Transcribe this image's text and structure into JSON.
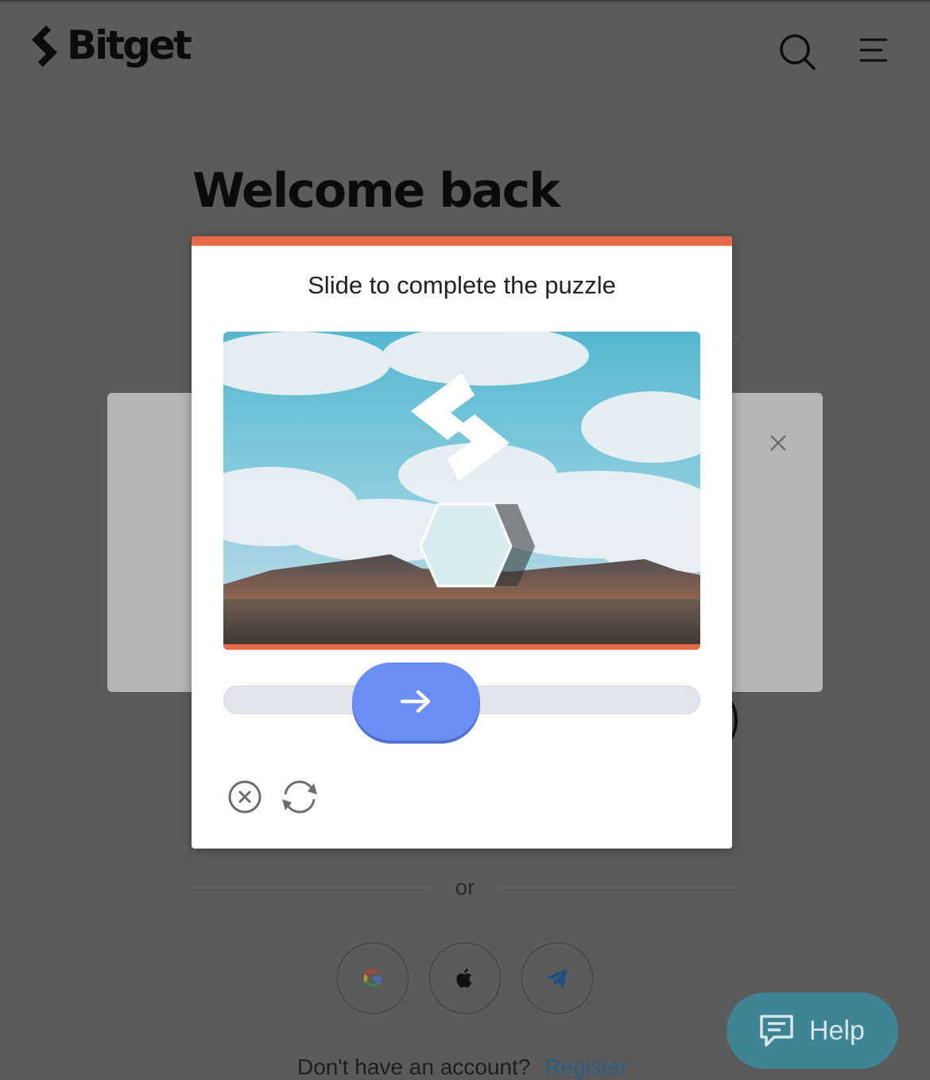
{
  "header": {
    "logo_text": "Bitget",
    "search_icon": "search-icon",
    "menu_icon": "menu-icon"
  },
  "page": {
    "title": "Welcome back",
    "or_label": "or",
    "no_account_text": "Don't have an account?",
    "register_link": "Register"
  },
  "social": [
    "google-icon",
    "apple-icon",
    "telegram-icon"
  ],
  "help": {
    "label": "Help",
    "icon": "chat-icon"
  },
  "captcha": {
    "title": "Slide to complete the puzzle",
    "slider_icon": "arrow-right-icon",
    "slider_position": 0.37,
    "close_icon": "close-circle-icon",
    "refresh_icon": "refresh-icon"
  },
  "colors": {
    "accent": "#e8684a",
    "slider": "#6a8ef3",
    "help": "#3e8494",
    "link": "#2b5d80"
  }
}
